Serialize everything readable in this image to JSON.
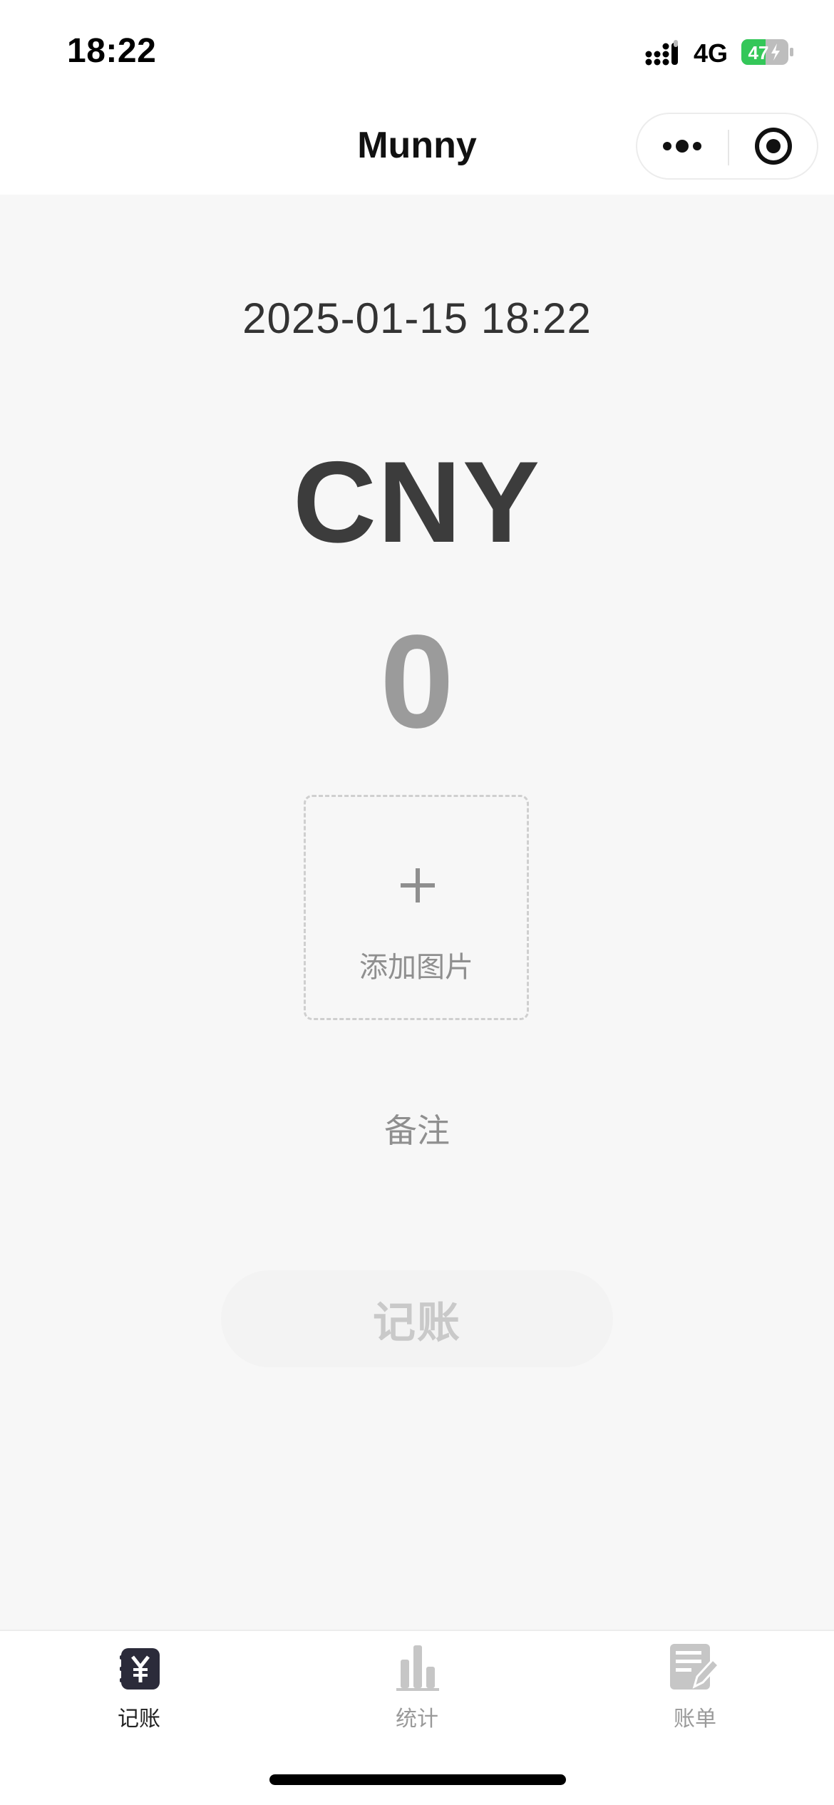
{
  "status_bar": {
    "time": "18:22",
    "network": "4G",
    "battery_level": "47",
    "battery_color": "#34c759"
  },
  "nav": {
    "title": "Munny",
    "more_icon": "more-dots-icon",
    "close_icon": "target-close-icon"
  },
  "entry": {
    "datetime": "2025-01-15  18:22",
    "currency": "CNY",
    "amount": "0",
    "add_image_label": "添加图片",
    "remark_placeholder": "备注",
    "submit_label": "记账"
  },
  "tabs": [
    {
      "label": "记账",
      "icon": "yen-book-icon",
      "active": true
    },
    {
      "label": "统计",
      "icon": "bar-chart-icon",
      "active": false
    },
    {
      "label": "账单",
      "icon": "bill-edit-icon",
      "active": false
    }
  ],
  "colors": {
    "accent_dark": "#2b2b3a",
    "inactive_icon": "#c6c6c6",
    "background": "#f7f7f7"
  }
}
